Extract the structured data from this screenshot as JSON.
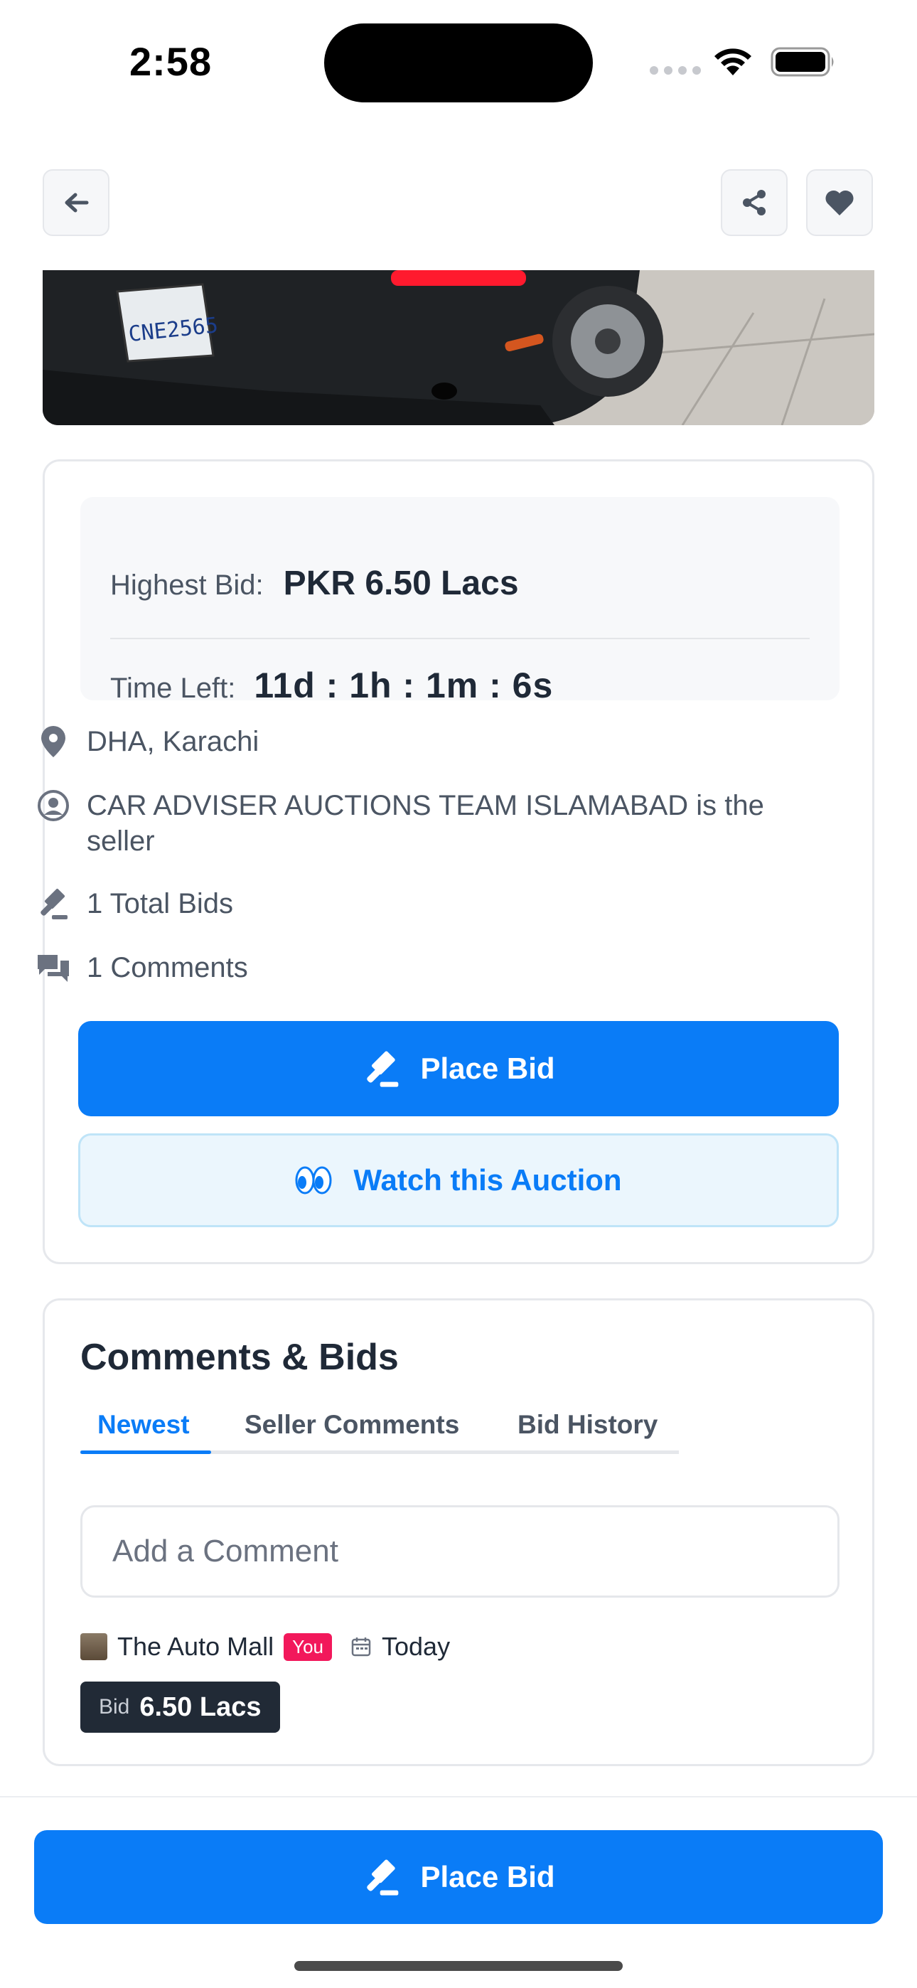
{
  "status_bar": {
    "time": "2:58"
  },
  "header": {
    "back_icon": "arrow-left-icon",
    "share_icon": "share-icon",
    "favorite_icon": "heart-icon"
  },
  "auction": {
    "highest_bid_label": "Highest Bid:",
    "highest_bid_value": "PKR 6.50 Lacs",
    "time_left_label": "Time Left:",
    "time_left_value": "11d : 1h : 1m : 6s",
    "location": "DHA, Karachi",
    "seller": "CAR ADVISER AUCTIONS TEAM ISLAMABAD is the seller",
    "total_bids": "1 Total Bids",
    "comments": "1 Comments",
    "place_bid_label": "Place Bid",
    "watch_label": "Watch this Auction"
  },
  "comments_section": {
    "title": "Comments & Bids",
    "tabs": [
      {
        "label": "Newest",
        "active": true
      },
      {
        "label": "Seller Comments",
        "active": false
      },
      {
        "label": "Bid History",
        "active": false
      }
    ],
    "input_placeholder": "Add a Comment",
    "entries": [
      {
        "author": "The Auto Mall",
        "badge": "You",
        "date": "Today",
        "bid_label": "Bid",
        "bid_value": "6.50 Lacs"
      }
    ]
  },
  "bottom_bar": {
    "place_bid_label": "Place Bid"
  },
  "colors": {
    "primary": "#0a7cf7",
    "badge": "#f2185b",
    "chip": "#212a36"
  }
}
